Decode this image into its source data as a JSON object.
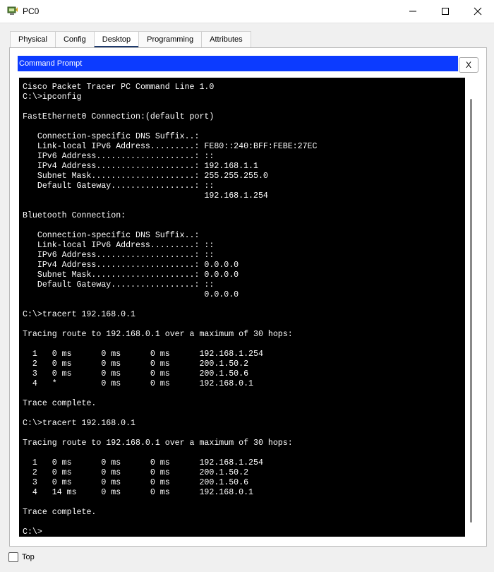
{
  "window": {
    "title": "PC0",
    "icon": "pc-icon"
  },
  "tabs": [
    {
      "label": "Physical",
      "active": false
    },
    {
      "label": "Config",
      "active": false
    },
    {
      "label": "Desktop",
      "active": true
    },
    {
      "label": "Programming",
      "active": false
    },
    {
      "label": "Attributes",
      "active": false
    }
  ],
  "command_prompt": {
    "title": "Command Prompt",
    "close_label": "X",
    "lines": [
      "Cisco Packet Tracer PC Command Line 1.0",
      "C:\\>ipconfig",
      "",
      "FastEthernet0 Connection:(default port)",
      "",
      "   Connection-specific DNS Suffix..:",
      "   Link-local IPv6 Address.........: FE80::240:BFF:FEBE:27EC",
      "   IPv6 Address....................: ::",
      "   IPv4 Address....................: 192.168.1.1",
      "   Subnet Mask.....................: 255.255.255.0",
      "   Default Gateway.................: ::",
      "                                     192.168.1.254",
      "",
      "Bluetooth Connection:",
      "",
      "   Connection-specific DNS Suffix..:",
      "   Link-local IPv6 Address.........: ::",
      "   IPv6 Address....................: ::",
      "   IPv4 Address....................: 0.0.0.0",
      "   Subnet Mask.....................: 0.0.0.0",
      "   Default Gateway.................: ::",
      "                                     0.0.0.0",
      "",
      "C:\\>tracert 192.168.0.1",
      "",
      "Tracing route to 192.168.0.1 over a maximum of 30 hops:",
      "",
      "  1   0 ms      0 ms      0 ms      192.168.1.254",
      "  2   0 ms      0 ms      0 ms      200.1.50.2",
      "  3   0 ms      0 ms      0 ms      200.1.50.6",
      "  4   *         0 ms      0 ms      192.168.0.1",
      "",
      "Trace complete.",
      "",
      "C:\\>tracert 192.168.0.1",
      "",
      "Tracing route to 192.168.0.1 over a maximum of 30 hops:",
      "",
      "  1   0 ms      0 ms      0 ms      192.168.1.254",
      "  2   0 ms      0 ms      0 ms      200.1.50.2",
      "  3   0 ms      0 ms      0 ms      200.1.50.6",
      "  4   14 ms     0 ms      0 ms      192.168.0.1",
      "",
      "Trace complete.",
      "",
      "C:\\>"
    ]
  },
  "footer": {
    "top_label": "Top",
    "top_checked": false
  },
  "colors": {
    "header_blue": "#0c3bff",
    "terminal_bg": "#000000",
    "terminal_fg": "#ffffff",
    "active_tab_underline": "#1e3a6e"
  }
}
